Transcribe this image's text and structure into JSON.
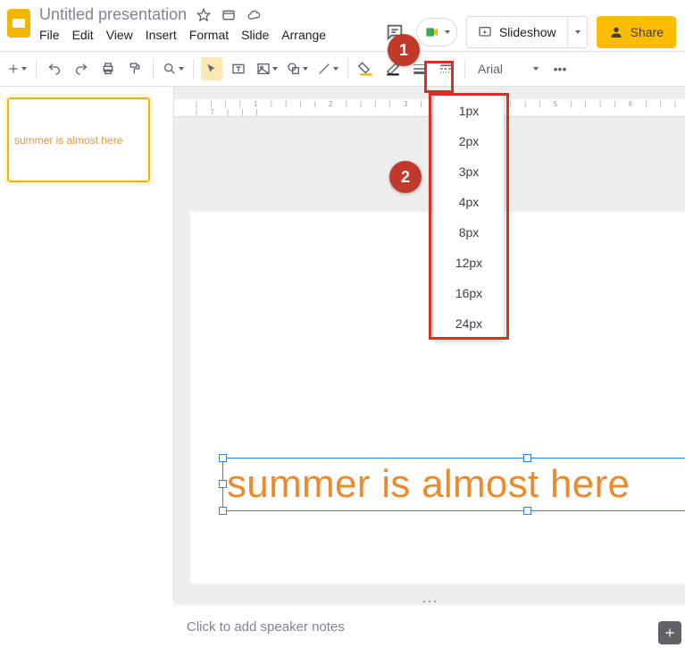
{
  "header": {
    "doc_title": "Untitled presentation",
    "menus": [
      "File",
      "Edit",
      "View",
      "Insert",
      "Format",
      "Slide",
      "Arrange"
    ],
    "slideshow_label": "Slideshow",
    "share_label": "Share"
  },
  "toolbar": {
    "font": "Arial"
  },
  "dropdown": {
    "options": [
      "1px",
      "2px",
      "3px",
      "4px",
      "8px",
      "12px",
      "16px",
      "24px"
    ]
  },
  "slide": {
    "thumb_text": "summer is almost here",
    "canvas_text": "summer is almost here"
  },
  "notes": {
    "placeholder": "Click to add speaker notes"
  },
  "annotations": {
    "a1": "1",
    "a2": "2"
  },
  "ruler_marks": "| | | | 1 | | | | 2 | | | | 3 | | | | 4 | | | | 5 | | | | 6 | | | | 7 | | |"
}
